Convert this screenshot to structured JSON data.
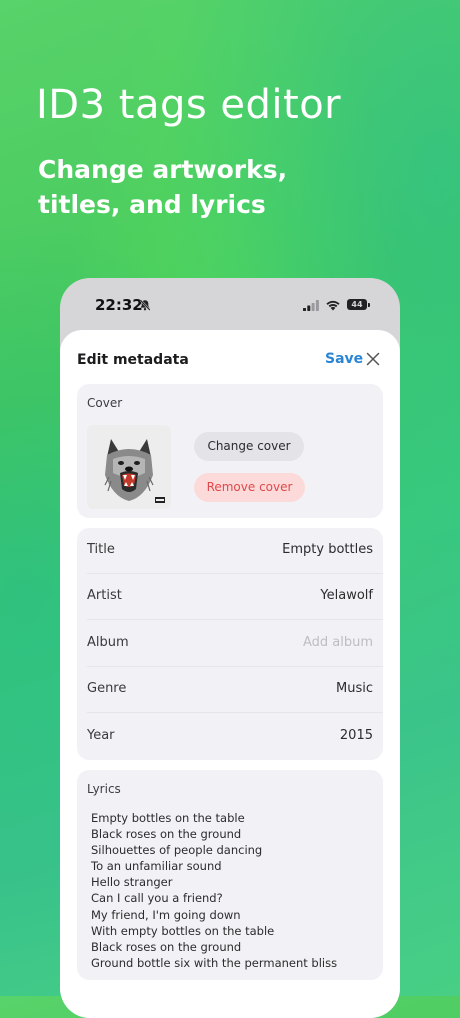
{
  "promo": {
    "headline": "ID3 tags editor",
    "subheadline": "Change artworks, titles, and lyrics"
  },
  "status_bar": {
    "time": "22:32",
    "battery": "44",
    "icons": [
      "bell-slash-icon",
      "signal-icon",
      "wifi-icon",
      "battery-icon"
    ]
  },
  "sheet": {
    "title": "Edit metadata",
    "save_label": "Save",
    "close_icon": "close-icon"
  },
  "cover": {
    "label": "Cover",
    "change_label": "Change cover",
    "remove_label": "Remove cover"
  },
  "fields": [
    {
      "label": "Title",
      "value": "Empty bottles",
      "placeholder": ""
    },
    {
      "label": "Artist",
      "value": "Yelawolf",
      "placeholder": ""
    },
    {
      "label": "Album",
      "value": "",
      "placeholder": "Add album"
    },
    {
      "label": "Genre",
      "value": "Music",
      "placeholder": ""
    },
    {
      "label": "Year",
      "value": "2015",
      "placeholder": ""
    }
  ],
  "lyrics": {
    "label": "Lyrics",
    "text": "Empty bottles on the table\nBlack roses on the ground\nSilhouettes of people dancing\nTo an unfamiliar sound\nHello stranger\nCan I call you a friend?\nMy friend, I'm going down\nWith empty bottles on the table\nBlack roses on the ground\nGround bottle six with the permanent bliss"
  },
  "colors": {
    "accent": "#2a86d4",
    "destructive": "#e0484a",
    "destructive_bg": "#fddada",
    "card_bg": "#f2f2f6",
    "background_green": "#45c95c"
  }
}
